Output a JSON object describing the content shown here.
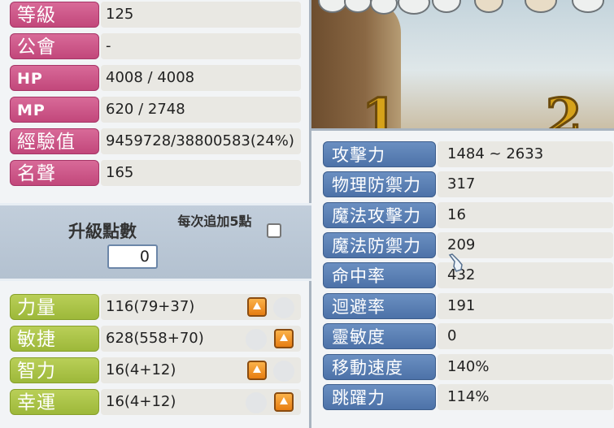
{
  "profile": [
    {
      "label": "等級",
      "value": "125"
    },
    {
      "label": "公會",
      "value": "-"
    },
    {
      "label": "HP",
      "value": "4008 / 4008"
    },
    {
      "label": "MP",
      "value": "620 / 2748"
    },
    {
      "label": "經驗值",
      "value": "9459728/38800583(24%)"
    },
    {
      "label": "名聲",
      "value": "165"
    }
  ],
  "ability_points": {
    "label": "升級點數",
    "value": "0",
    "plus5_label": "每次追加5點",
    "plus5_checked": false
  },
  "base_stats": [
    {
      "label": "力量",
      "value": "116(79+37)",
      "up_icon": "arrow-up-icon",
      "up_position": "left"
    },
    {
      "label": "敏捷",
      "value": "628(558+70)",
      "up_icon": "arrow-up-icon",
      "up_position": "right"
    },
    {
      "label": "智力",
      "value": "16(4+12)",
      "up_icon": "arrow-up-icon",
      "up_position": "left"
    },
    {
      "label": "幸運",
      "value": "16(4+12)",
      "up_icon": "arrow-up-icon",
      "up_position": "right"
    }
  ],
  "detail_stats": [
    {
      "label": "攻擊力",
      "value": "1484 ~ 2633"
    },
    {
      "label": "物理防禦力",
      "value": "317"
    },
    {
      "label": "魔法攻擊力",
      "value": "16"
    },
    {
      "label": "魔法防禦力",
      "value": "209"
    },
    {
      "label": "命中率",
      "value": "432"
    },
    {
      "label": "迴避率",
      "value": "191"
    },
    {
      "label": "靈敏度",
      "value": "0"
    },
    {
      "label": "移動速度",
      "value": "140%"
    },
    {
      "label": "跳躍力",
      "value": "114%"
    }
  ],
  "scene": {
    "digits": [
      "1",
      "2"
    ]
  },
  "colors": {
    "pink_label": "#c2477b",
    "green_label": "#9db83a",
    "blue_label": "#4d72a8",
    "up_button": "#e67d12"
  }
}
